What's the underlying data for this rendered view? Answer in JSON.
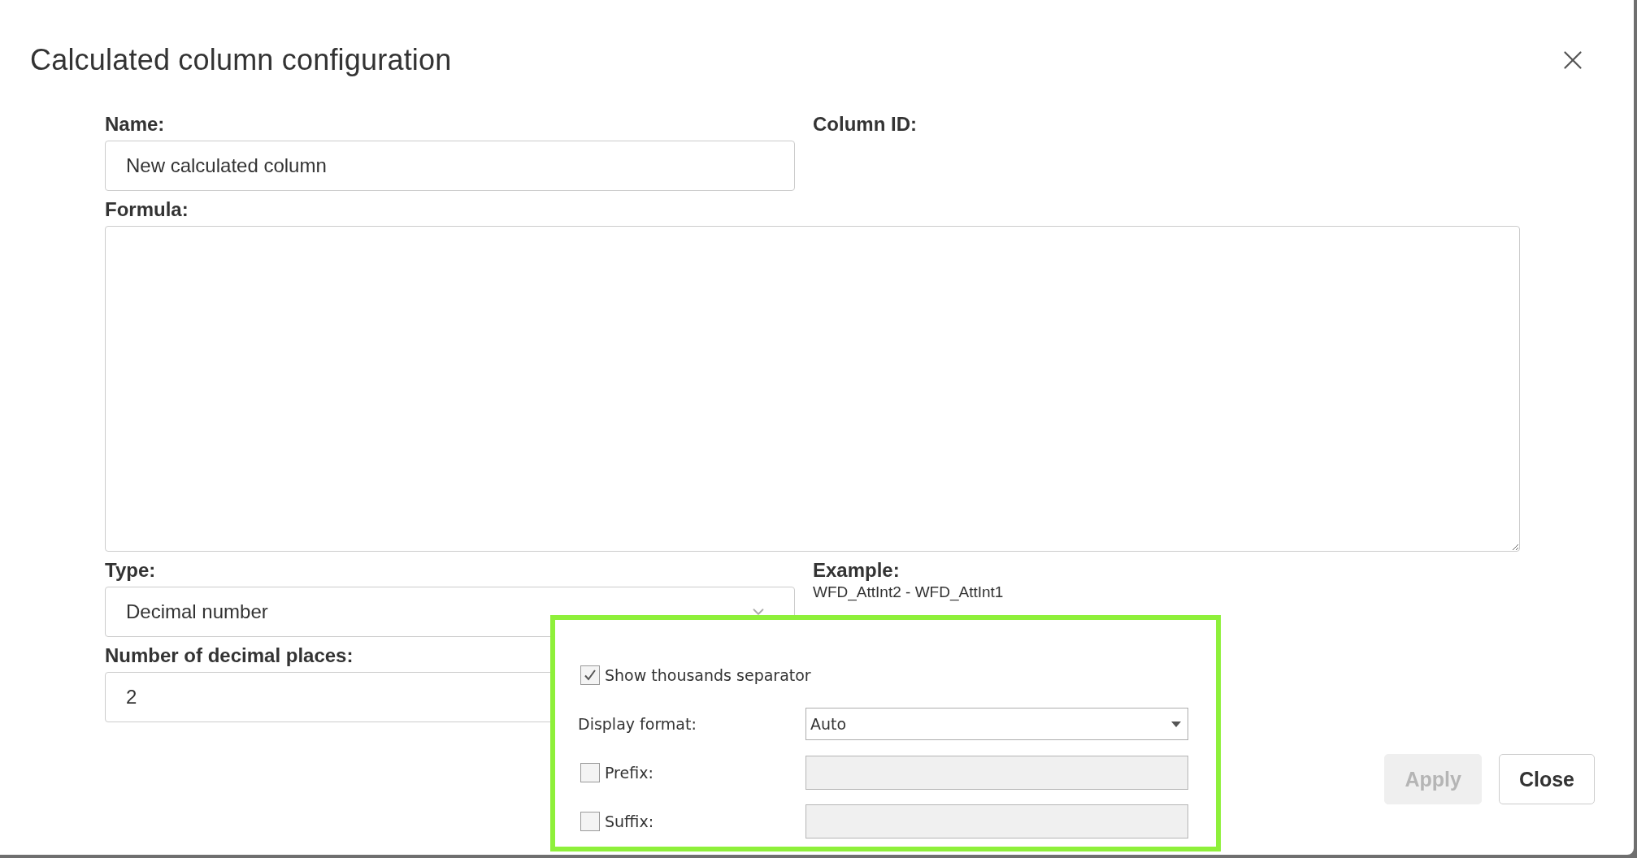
{
  "dialog": {
    "title": "Calculated column configuration"
  },
  "form": {
    "name": {
      "label": "Name:",
      "value": "New calculated column"
    },
    "column_id": {
      "label": "Column ID:"
    },
    "formula": {
      "label": "Formula:"
    },
    "type": {
      "label": "Type:",
      "value": "Decimal number"
    },
    "example": {
      "label": "Example:",
      "value": "WFD_AttInt2 - WFD_AttInt1"
    },
    "decimal_places": {
      "label": "Number of decimal places:",
      "value": "2"
    }
  },
  "format_popup": {
    "thousands_separator": {
      "label": "Show thousands separator",
      "checked": true
    },
    "display_format": {
      "label": "Display format:",
      "value": "Auto"
    },
    "prefix": {
      "label": "Prefix:",
      "checked": false
    },
    "suffix": {
      "label": "Suffix:",
      "checked": false
    }
  },
  "buttons": [
    {
      "label": "Apply",
      "disabled": true
    },
    {
      "label": "Close",
      "disabled": false
    }
  ]
}
